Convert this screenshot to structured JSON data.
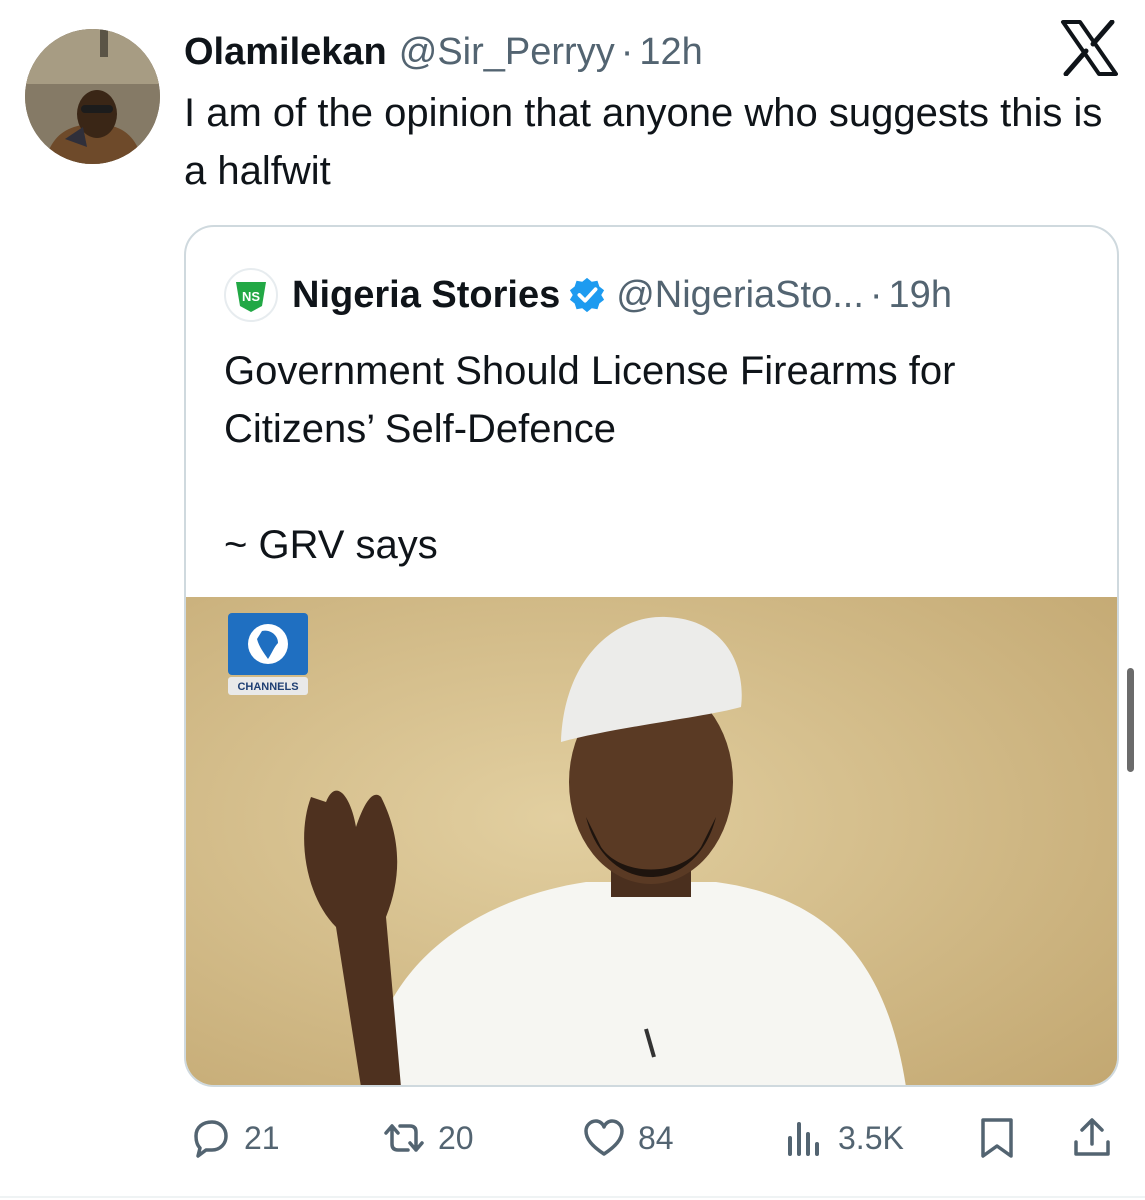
{
  "tweet": {
    "author_name": "Olamilekan",
    "author_handle": "@Sir_Perryy",
    "separator": "·",
    "time": "12h",
    "text": "I am of the opinion that anyone who suggests this is a halfwit"
  },
  "quoted_tweet": {
    "author_name": "Nigeria Stories",
    "verified": true,
    "author_handle": "@NigeriaSto...",
    "separator": "·",
    "time": "19h",
    "text_lines": [
      "Government Should License Firearms for Citizens’ Self-Defence",
      "~ GRV says"
    ],
    "avatar_logo_text": "NS",
    "media_watermark": "CHANNELS"
  },
  "actions": {
    "replies": "21",
    "reposts": "20",
    "likes": "84",
    "views": "3.5K"
  },
  "icons": [
    "x-logo-icon",
    "verified-badge-icon",
    "reply-icon",
    "repost-icon",
    "like-icon",
    "views-icon",
    "bookmark-icon",
    "share-icon"
  ],
  "colors": {
    "text": "#0f1419",
    "secondary": "#536471",
    "verified_blue": "#1d9bf0",
    "border": "#cfd9de",
    "media_background": "#cdb37d"
  }
}
